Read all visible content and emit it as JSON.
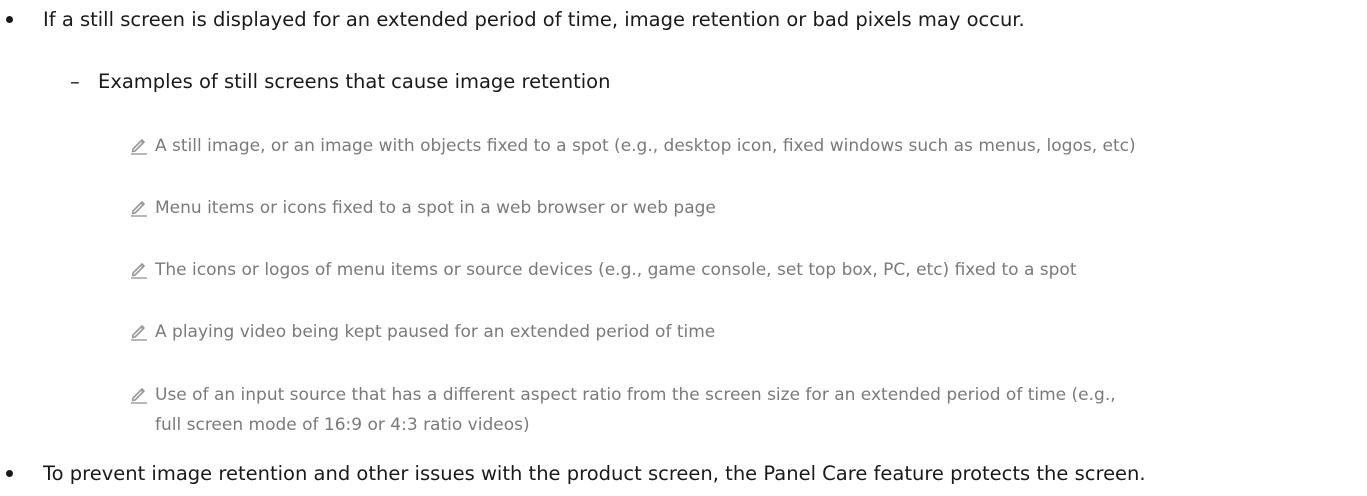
{
  "bullets": [
    "If a still screen is displayed for an extended period of time, image retention or bad pixels may occur.",
    "To prevent image retention and other issues with the product screen, the Panel Care feature protects the screen."
  ],
  "dash_item": "Examples of still screens that cause image retention",
  "dash_mark": "–",
  "notes": [
    "A still image, or an image with objects fixed to a spot (e.g., desktop icon, fixed windows such as menus, logos, etc)",
    "Menu items or icons fixed to a spot in a web browser or web page",
    "The icons or logos of menu items or source devices (e.g., game console, set top box, PC, etc) fixed to a spot",
    "A playing video being kept paused for an extended period of time",
    "Use of an input source that has a different aspect ratio from the screen size for an extended period of time (e.g.,"
  ],
  "note_continuation": "full screen mode of 16:9 or 4:3 ratio videos)",
  "colors": {
    "text": "#1a1a1a",
    "note_text": "#7a7a7a",
    "pencil_icon": "#9a9a9a"
  },
  "icons": {
    "note": "pencil-icon"
  }
}
